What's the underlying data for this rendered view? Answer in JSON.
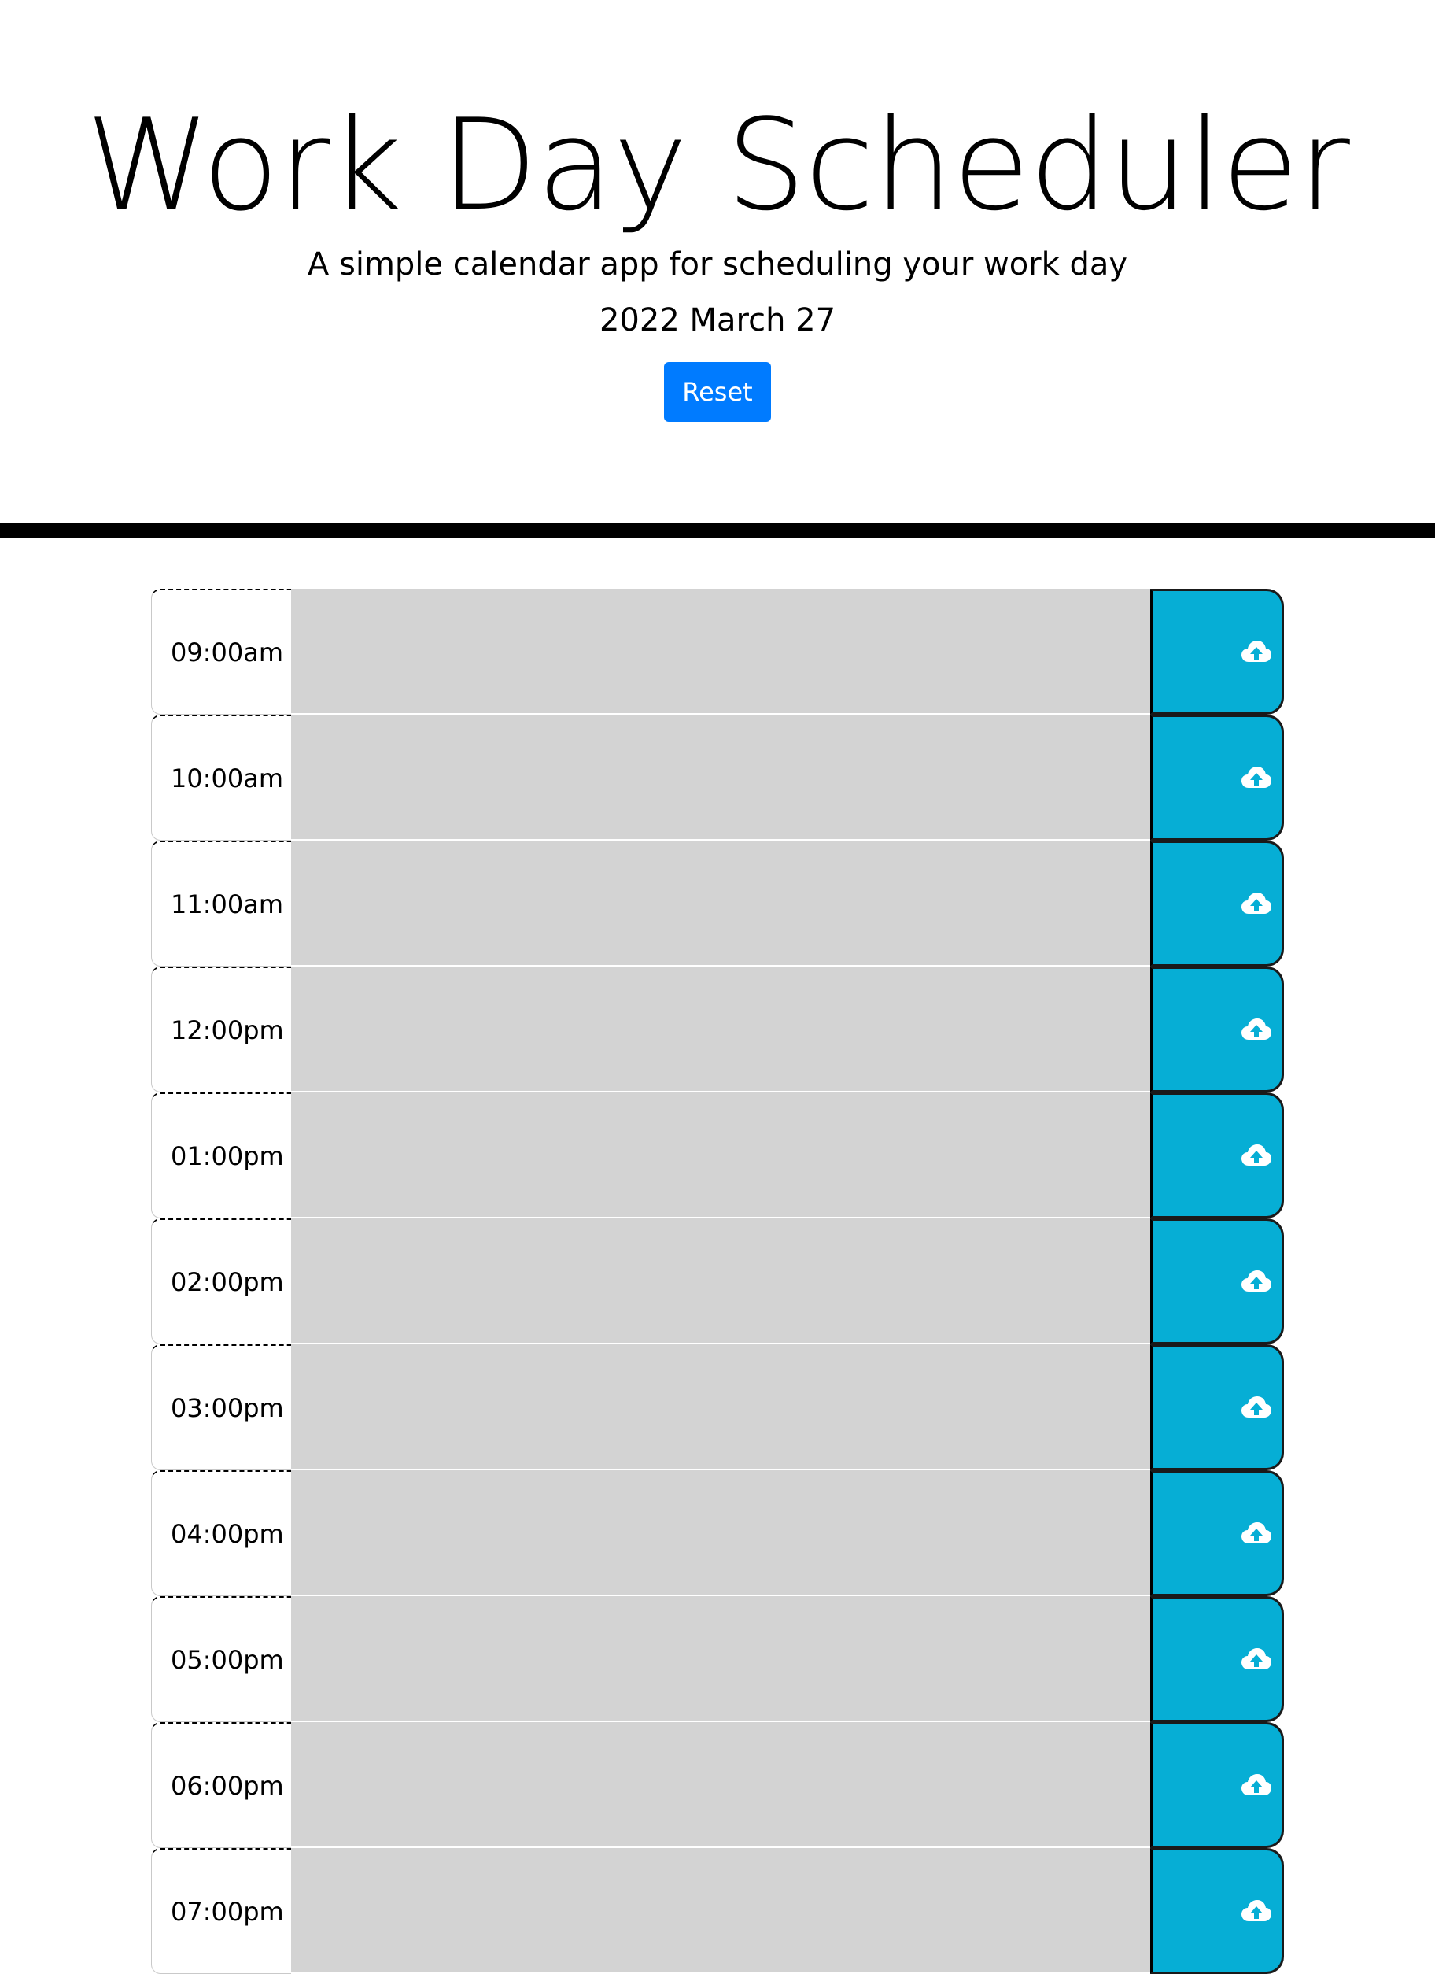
{
  "header": {
    "title": "Work Day Scheduler",
    "lead": "A simple calendar app for scheduling your work day",
    "current_day": "2022 March 27",
    "reset_label": "Reset",
    "reset_color": "#007bff"
  },
  "colors": {
    "block_fill": "#d3d3d3",
    "save_button": "#06aed5",
    "divider": "#000000"
  },
  "save_icon": "cloud-upload-icon",
  "schedule": {
    "blocks": [
      {
        "hour": "09:00am",
        "text": ""
      },
      {
        "hour": "10:00am",
        "text": ""
      },
      {
        "hour": "11:00am",
        "text": ""
      },
      {
        "hour": "12:00pm",
        "text": ""
      },
      {
        "hour": "01:00pm",
        "text": ""
      },
      {
        "hour": "02:00pm",
        "text": ""
      },
      {
        "hour": "03:00pm",
        "text": ""
      },
      {
        "hour": "04:00pm",
        "text": ""
      },
      {
        "hour": "05:00pm",
        "text": ""
      },
      {
        "hour": "06:00pm",
        "text": ""
      },
      {
        "hour": "07:00pm",
        "text": ""
      }
    ]
  }
}
